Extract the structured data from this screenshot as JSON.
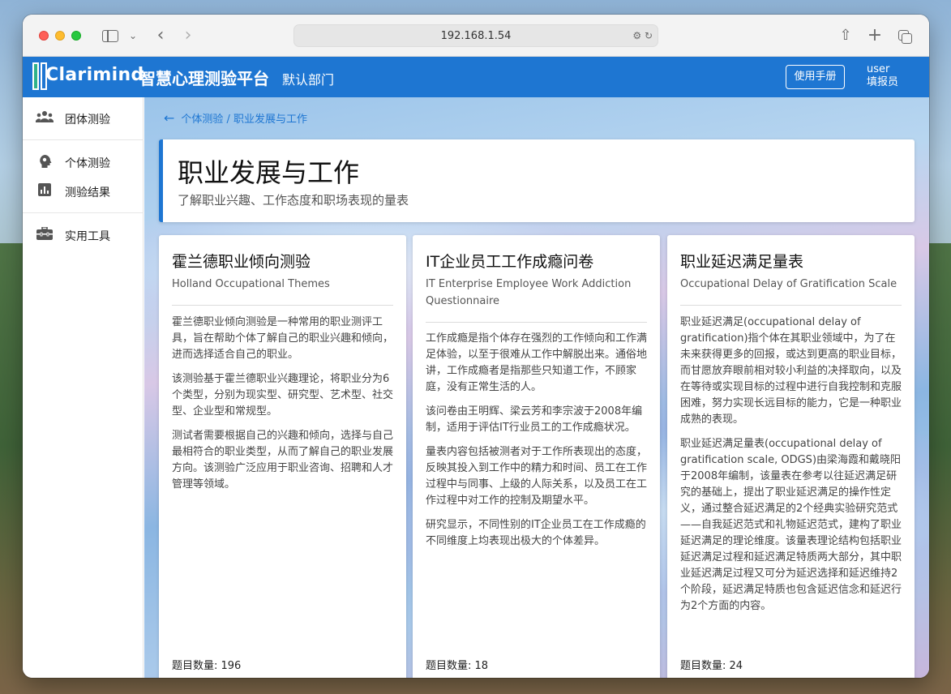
{
  "browser": {
    "address": "192.168.1.54"
  },
  "header": {
    "brand": "Clarimind",
    "platform": "智慧心理测验平台",
    "department": "默认部门",
    "manual_label": "使用手册",
    "user_name": "user",
    "user_role": "填报员"
  },
  "sidebar": {
    "items": [
      {
        "label": "团体测验",
        "icon": "group-icon"
      },
      {
        "label": "个体测验",
        "icon": "head-icon"
      },
      {
        "label": "测验结果",
        "icon": "bar-chart-icon"
      },
      {
        "label": "实用工具",
        "icon": "toolbox-icon"
      }
    ]
  },
  "breadcrumb": {
    "text": "个体测验 / 职业发展与工作"
  },
  "page": {
    "title": "职业发展与工作",
    "subtitle": "了解职业兴趣、工作态度和职场表现的量表"
  },
  "cards": [
    {
      "title": "霍兰德职业倾向测验",
      "subtitle": "Holland Occupational Themes",
      "paragraphs": [
        "霍兰德职业倾向测验是一种常用的职业测评工具，旨在帮助个体了解自己的职业兴趣和倾向，进而选择适合自己的职业。",
        "该测验基于霍兰德职业兴趣理论，将职业分为6个类型，分别为现实型、研究型、艺术型、社交型、企业型和常规型。",
        "测试者需要根据自己的兴趣和倾向，选择与自己最相符合的职业类型，从而了解自己的职业发展方向。该测验广泛应用于职业咨询、招聘和人才管理等领域。"
      ],
      "count": "题目数量: 196"
    },
    {
      "title": "IT企业员工工作成瘾问卷",
      "subtitle": "IT Enterprise Employee Work Addiction Questionnaire",
      "paragraphs": [
        "工作成瘾是指个体存在强烈的工作倾向和工作满足体验，以至于很难从工作中解脱出来。通俗地讲，工作成瘾者是指那些只知道工作，不顾家庭，没有正常生活的人。",
        "该问卷由王明辉、梁云芳和李宗波于2008年编制，适用于评估IT行业员工的工作成瘾状况。",
        "量表内容包括被测者对于工作所表现出的态度，反映其投入到工作中的精力和时间、员工在工作过程中与同事、上级的人际关系，以及员工在工作过程中对工作的控制及期望水平。",
        "研究显示，不同性别的IT企业员工在工作成瘾的不同维度上均表现出极大的个体差异。"
      ],
      "count": "题目数量: 18"
    },
    {
      "title": "职业延迟满足量表",
      "subtitle": "Occupational Delay of Gratification Scale",
      "paragraphs": [
        "职业延迟满足(occupational delay of gratification)指个体在其职业领域中，为了在未来获得更多的回报，或达到更高的职业目标，而甘愿放弃眼前相对较小利益的决择取向，以及在等待或实现目标的过程中进行自我控制和克服困难，努力实现长远目标的能力，它是一种职业成熟的表现。",
        "职业延迟满足量表(occupational delay of gratification scale, ODGS)由梁海霞和戴晓阳于2008年编制，该量表在参考以往延迟满足研究的基础上，提出了职业延迟满足的操作性定义，通过整合延迟满足的2个经典实验研究范式——自我延迟范式和礼物延迟范式，建构了职业延迟满足的理论维度。该量表理论结构包括职业延迟满足过程和延迟满足特质两大部分，其中职业延迟满足过程又可分为延迟选择和延迟维持2个阶段，延迟满足特质也包含延迟信念和延迟行为2个方面的内容。"
      ],
      "count": "题目数量: 24"
    }
  ]
}
